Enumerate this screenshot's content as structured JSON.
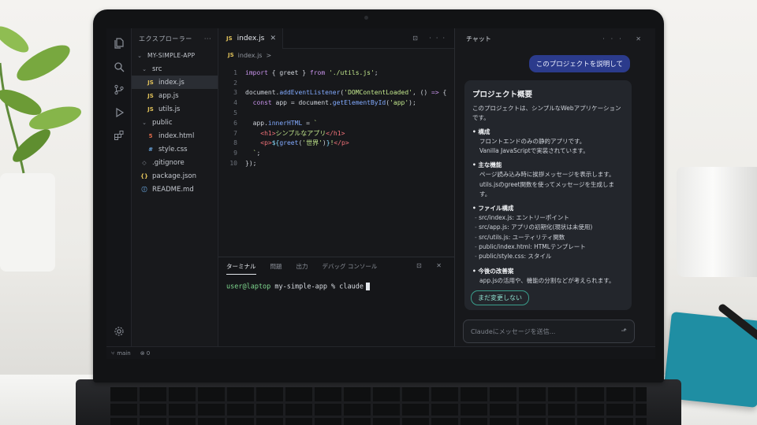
{
  "colors": {
    "accent": "#2b3b8c",
    "terminal_user": "#7fd88f",
    "js_badge": "#e0c15a",
    "pill_border": "#3a9e8c"
  },
  "activity_icons": [
    "files-icon",
    "search-icon",
    "source-control-icon",
    "run-debug-icon",
    "extensions-icon",
    "settings-gear-icon"
  ],
  "explorer": {
    "title": "エクスプローラー",
    "more": "···",
    "project": "MY-SIMPLE-APP",
    "items": [
      {
        "label": "src",
        "icon": "",
        "indent": 1,
        "chevron": "⌄"
      },
      {
        "label": "index.js",
        "icon": "JS",
        "indent": 2,
        "selected": true
      },
      {
        "label": "app.js",
        "icon": "JS",
        "indent": 2
      },
      {
        "label": "utils.js",
        "icon": "JS",
        "indent": 2
      },
      {
        "label": "public",
        "icon": "",
        "indent": 1,
        "chevron": "⌄"
      },
      {
        "label": "index.html",
        "icon": "5",
        "indent": 2
      },
      {
        "label": "style.css",
        "icon": "#",
        "indent": 2
      },
      {
        "label": ".gitignore",
        "icon": "◇",
        "indent": 1
      },
      {
        "label": "package.json",
        "icon": "{}",
        "indent": 1
      },
      {
        "label": "README.md",
        "icon": "ⓘ",
        "indent": 1
      }
    ]
  },
  "editor": {
    "tab_icon": "JS",
    "tab_label": "index.js",
    "tab_close": "✕",
    "breadcrumb": "index.js",
    "breadcrumb_sep": ">",
    "line_numbers": [
      "1",
      "2",
      "3",
      "4",
      "5",
      "6",
      "7",
      "8",
      "9",
      "10"
    ]
  },
  "terminal": {
    "tabs": [
      "ターミナル",
      "問題",
      "出力",
      "デバッグ コンソール"
    ],
    "user": "user@laptop",
    "path": " my-simple-app % claude"
  },
  "statusbar": {
    "branch": "main",
    "errors": "⊗ 0"
  },
  "chat": {
    "title": "チャット",
    "user_message": "このプロジェクトを説明して",
    "heading": "プロジェクト概要",
    "intro": "このプロジェクトは、シンプルなWebアプリケーションです。",
    "sections": [
      {
        "title": "構成",
        "body": "フロントエンドのみの静的アプリです。\nVanilla JavaScriptで実装されています。"
      },
      {
        "title": "主な機能",
        "body": "ページ読み込み時に挨拶メッセージを表示します。\nutils.jsのgreet関数を使ってメッセージを生成します。"
      },
      {
        "title": "ファイル構成",
        "list": [
          "src/index.js: エントリーポイント",
          "src/app.js: アプリの初期化(現状は未使用)",
          "src/utils.js: ユーティリティ関数",
          "public/index.html: HTMLテンプレート",
          "public/style.css: スタイル"
        ]
      },
      {
        "title": "今後の改善案",
        "body": "app.jsの活用や、機能の分割などが考えられます。"
      }
    ],
    "pill": "まだ変更しない",
    "input_placeholder": "Claudeにメッセージを送信..."
  }
}
